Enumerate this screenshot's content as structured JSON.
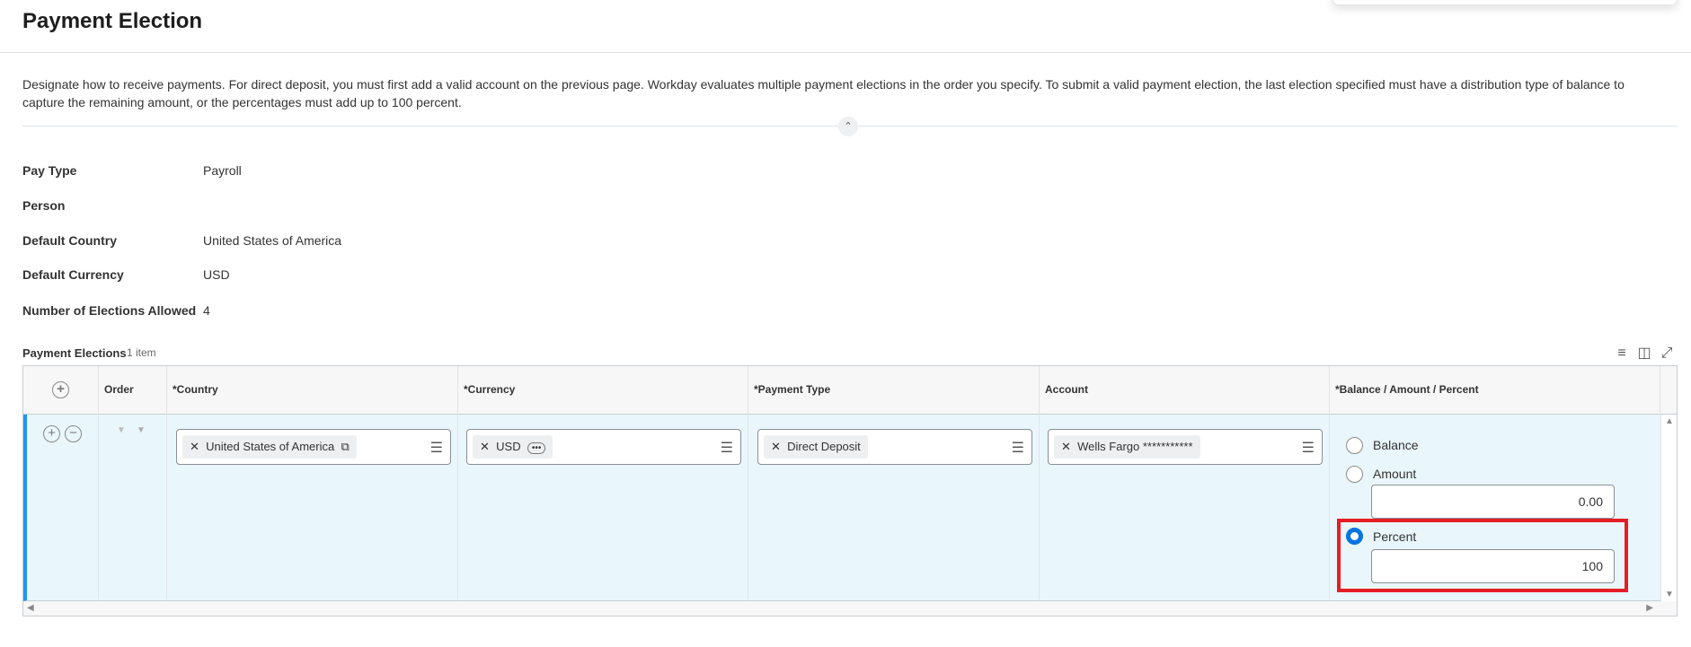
{
  "page": {
    "title": "Payment Election",
    "description": "Designate how to receive payments. For direct deposit, you must first add a valid account on the previous page. Workday evaluates multiple payment elections in the order you specify. To submit a valid payment election, the last election specified must have a distribution type of balance to capture the remaining amount, or the percentages must add up to 100 percent."
  },
  "fields": [
    {
      "label": "Pay Type",
      "value": "Payroll"
    },
    {
      "label": "Person",
      "value": ""
    },
    {
      "label": "Default Country",
      "value": "United States of America"
    },
    {
      "label": "Default Currency",
      "value": "USD"
    },
    {
      "label": "Number of Elections Allowed",
      "value": "4"
    }
  ],
  "elections": {
    "title": "Payment Elections",
    "count": "1 item",
    "columns": [
      "Order",
      "*Country",
      "*Currency",
      "*Payment Type",
      "Account",
      "*Balance / Amount / Percent"
    ],
    "row": {
      "country": "United States of America",
      "currency": "USD",
      "payment_type": "Direct Deposit",
      "account": "Wells Fargo ***********",
      "options": {
        "balance": "Balance",
        "amount": "Amount",
        "percent": "Percent"
      },
      "selected": "Percent",
      "amount_value": "0.00",
      "percent_value": "100"
    }
  },
  "colors": {
    "accent": "#0875e1",
    "highlight": "#e41e26",
    "row_bg": "#e9f6fb"
  }
}
